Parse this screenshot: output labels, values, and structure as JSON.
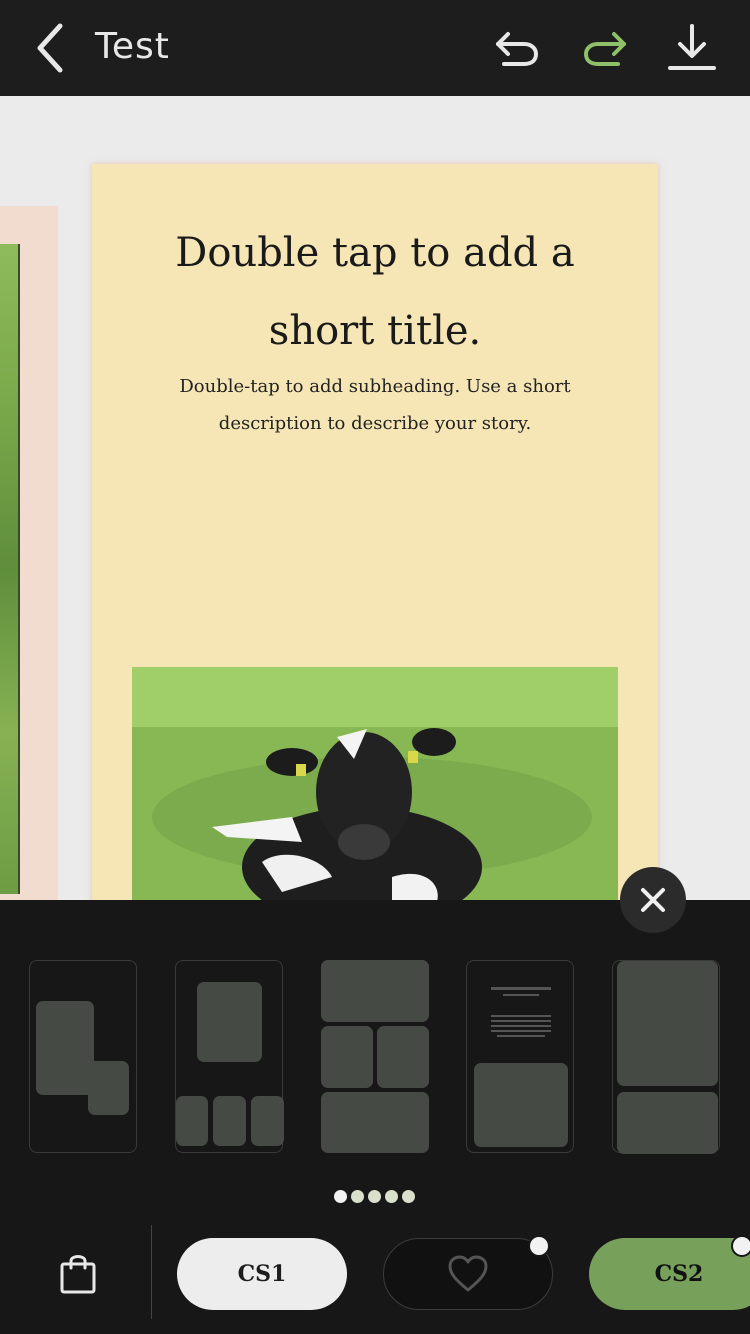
{
  "header": {
    "title": "Test"
  },
  "story_page": {
    "title": "Double tap to add a short title.",
    "subheading": "Double-tap to add subheading. Use a short description to describe your story."
  },
  "templates": [
    {
      "name": "template-overlap"
    },
    {
      "name": "template-one-plus-three"
    },
    {
      "name": "template-grid"
    },
    {
      "name": "template-text-photo"
    },
    {
      "name": "template-two-stack"
    }
  ],
  "pager": {
    "total": 5,
    "active": 0
  },
  "collections": {
    "cs1_label": "CS1",
    "cs2_label": "CS2"
  },
  "colors": {
    "topbar": "#1d1d1d",
    "page_background": "#f7e6b5",
    "accent_green": "#77a05a",
    "panel": "#171717"
  },
  "icons": {
    "back": "back-icon",
    "undo": "undo-icon",
    "redo": "redo-icon",
    "download": "download-icon",
    "close": "close-icon",
    "bag": "shopping-bag-icon",
    "heart": "heart-icon"
  }
}
